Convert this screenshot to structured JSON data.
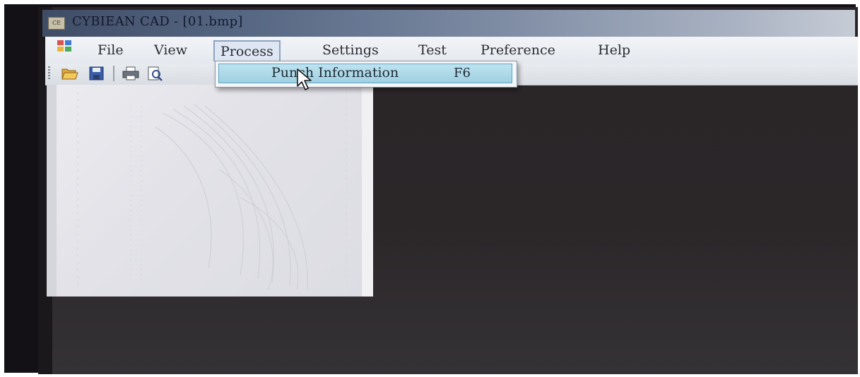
{
  "window": {
    "title": "CYBIEAN CAD - [01.bmp]",
    "app_icon_text": "CE"
  },
  "menubar": {
    "items": [
      {
        "label": "File"
      },
      {
        "label": "View"
      },
      {
        "label": "Process"
      },
      {
        "label": "Settings"
      },
      {
        "label": "Test"
      },
      {
        "label": "Preference"
      },
      {
        "label": "Help"
      }
    ],
    "active": "Process"
  },
  "toolbar": {
    "buttons": [
      "open-folder-icon",
      "save-icon",
      "print-icon",
      "print-preview-icon"
    ]
  },
  "dropdown": {
    "items": [
      {
        "label": "Punch Information",
        "shortcut": "F6",
        "highlighted": true
      }
    ]
  },
  "colors": {
    "title_bar_start": "#3f4c66",
    "dropdown_highlight": "#a9d6e6",
    "workspace": "#2a2528"
  }
}
